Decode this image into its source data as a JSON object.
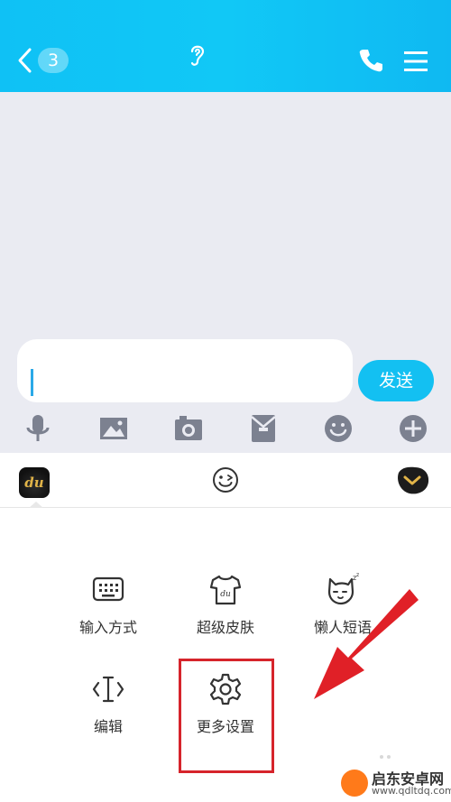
{
  "header": {
    "back_badge": "3",
    "background": "#11c8f6"
  },
  "composer": {
    "send_label": "发送",
    "input_value": "",
    "accent": "#13c0f2"
  },
  "toolbar_icons": [
    "microphone-icon",
    "image-icon",
    "camera-icon",
    "red-envelope-icon",
    "emoji-icon",
    "plus-icon"
  ],
  "keyboard_bar": {
    "logo_text": "du"
  },
  "menu": {
    "items": [
      {
        "label": "输入方式",
        "icon": "keyboard-icon"
      },
      {
        "label": "超级皮肤",
        "icon": "tshirt-icon"
      },
      {
        "label": "懒人短语",
        "icon": "sleepy-cat-icon"
      },
      {
        "label": "编辑",
        "icon": "text-cursor-icon"
      },
      {
        "label": "更多设置",
        "icon": "gear-icon"
      }
    ]
  },
  "annotation": {
    "highlight_color": "#d6242b"
  },
  "watermark": {
    "title": "启东安卓网",
    "url": "www.qdltdq.com"
  }
}
